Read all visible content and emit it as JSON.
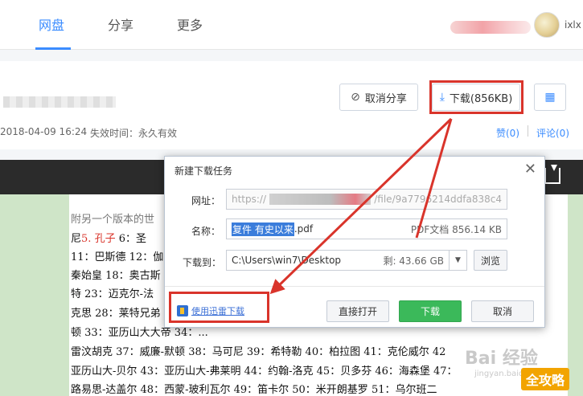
{
  "nav": {
    "tabs": [
      {
        "label": "网盘"
      },
      {
        "label": "分享"
      },
      {
        "label": "更多"
      }
    ],
    "user_text": "ixlx"
  },
  "file": {
    "cancel_share": "取消分享",
    "download": "下载(856KB)",
    "date": "2018-04-09 16:24",
    "expire": "失效时间：永久有效",
    "like": "赞(0)",
    "comment": "评论(0)"
  },
  "doc": {
    "lines": [
      {
        "text": "附另一个版本的世"
      },
      {
        "pre": "尼",
        "red1": "5.",
        "red2": "孔子",
        "post": " 6：圣"
      },
      {
        "text": "11：巴斯德 12：伽"
      },
      {
        "text": "秦始皇 18：奥古斯"
      },
      {
        "text": "特 23：迈克尔-法"
      },
      {
        "text": "克思 28：莱特兄弟"
      },
      {
        "text": "顿 33：亚历山大大帝 34：..."
      },
      {
        "text": "雷汶胡克 37：威廉-默顿 38：马可尼 39：希特勒 40：柏拉图 41：克伦威尔 42"
      },
      {
        "text": "亚历山大-贝尔 43：亚历山大-弗莱明 44：约翰-洛克 45：贝多芬 46：海森堡 47："
      },
      {
        "text": "路易思-达盖尔 48：西蒙-玻利瓦尔 49：笛卡尔 50：米开朗基罗 51：乌尔班二"
      }
    ],
    "watermark": "Bai 经验",
    "watermark_sub": "jingyan.baidu.com",
    "badge": "全攻略"
  },
  "dialog": {
    "title": "新建下载任务",
    "url_label": "网址：",
    "url_prefix": "https://",
    "url_suffix": "/file/9a7796214ddfa838c4",
    "name_label": "名称：",
    "name_selected": "复件 有史以来",
    "name_ext": ".pdf",
    "name_info": "PDF文档 856.14 KB",
    "path_label": "下载到：",
    "path_value": "C:\\Users\\win7\\Desktop",
    "path_free": "剩: 43.66 GB",
    "browse": "浏览",
    "xunlei": "使用迅雷下载",
    "open_direct": "直接打开",
    "download": "下载",
    "cancel": "取消"
  },
  "colors": {
    "accent": "#3b8cff",
    "highlight": "#d9342b",
    "primary_button": "#3bb95a"
  }
}
